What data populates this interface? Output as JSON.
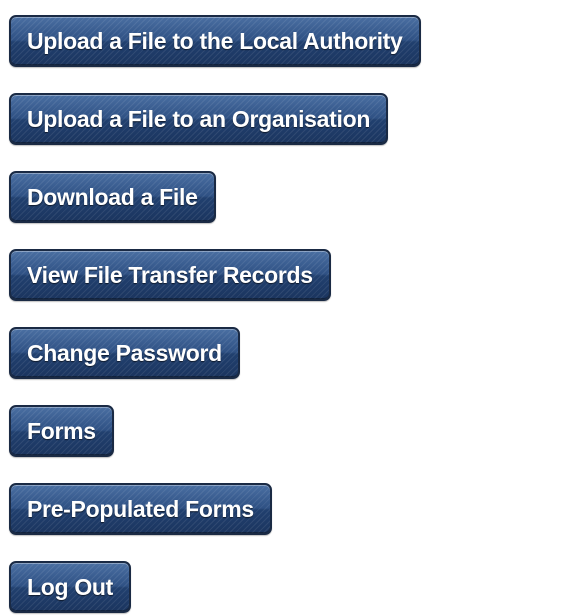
{
  "menu": {
    "items": [
      {
        "label": "Upload a File to the Local Authority"
      },
      {
        "label": "Upload a File to an Organisation"
      },
      {
        "label": "Download a File"
      },
      {
        "label": "View File Transfer Records"
      },
      {
        "label": "Change Password"
      },
      {
        "label": "Forms"
      },
      {
        "label": "Pre-Populated Forms"
      },
      {
        "label": "Log Out"
      }
    ],
    "colors": {
      "button_top": "#4a6fa2",
      "button_bottom": "#1b355f",
      "button_border": "#1a2a44",
      "button_text": "#ffffff",
      "page_background": "#ffffff"
    }
  }
}
